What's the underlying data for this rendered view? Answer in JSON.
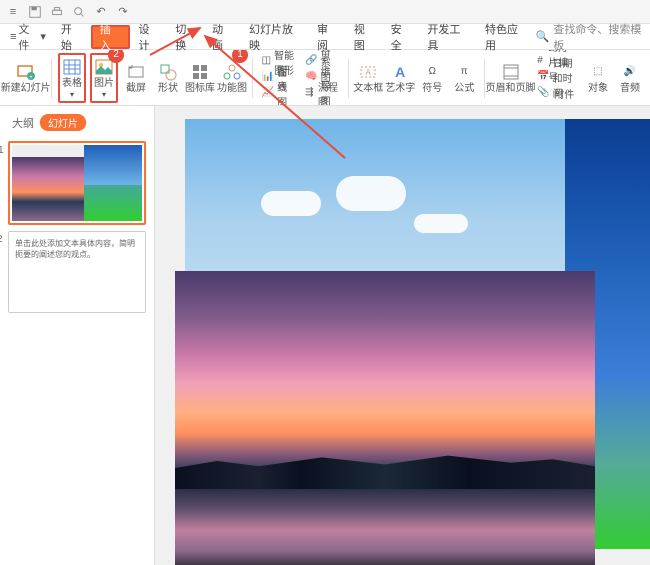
{
  "qat": {
    "file_label": "文件"
  },
  "tabs": {
    "items": [
      "开始",
      "插入",
      "设计",
      "切换",
      "动画",
      "幻灯片放映",
      "审阅",
      "视图",
      "安全",
      "开发工具",
      "特色应用"
    ],
    "active_index": 1,
    "search_hint": "查找命令、搜索模板",
    "search_icon_label": "查找"
  },
  "ribbon": {
    "new_slide": "新建幻灯片",
    "table": "表格",
    "picture": "图片",
    "screenshot": "截屏",
    "shapes": "形状",
    "icon_lib": "图标库",
    "smart_gfx": "功能图",
    "smartart": "智能图形",
    "chart": "图表",
    "online_chart": "在线图表",
    "relation": "关系图",
    "mindmap": "思维导图",
    "flowchart": "流程图",
    "textbox": "文本框",
    "wordart": "艺术字",
    "symbol": "符号",
    "equation": "公式",
    "header_footer": "页眉和页脚",
    "slide_number": "幻灯片编号",
    "datetime": "日期和时间",
    "object": "对象",
    "attachment": "附件",
    "audio": "音频"
  },
  "annotations": {
    "badge1": "1",
    "badge2": "2"
  },
  "sidepanel": {
    "tab_outline": "大纲",
    "tab_slides": "幻灯片",
    "thumb1_num": "1",
    "thumb2_num": "2",
    "thumb2_text": "单击此处添加文本具体内容，简明扼要的阐述您的观点。"
  }
}
